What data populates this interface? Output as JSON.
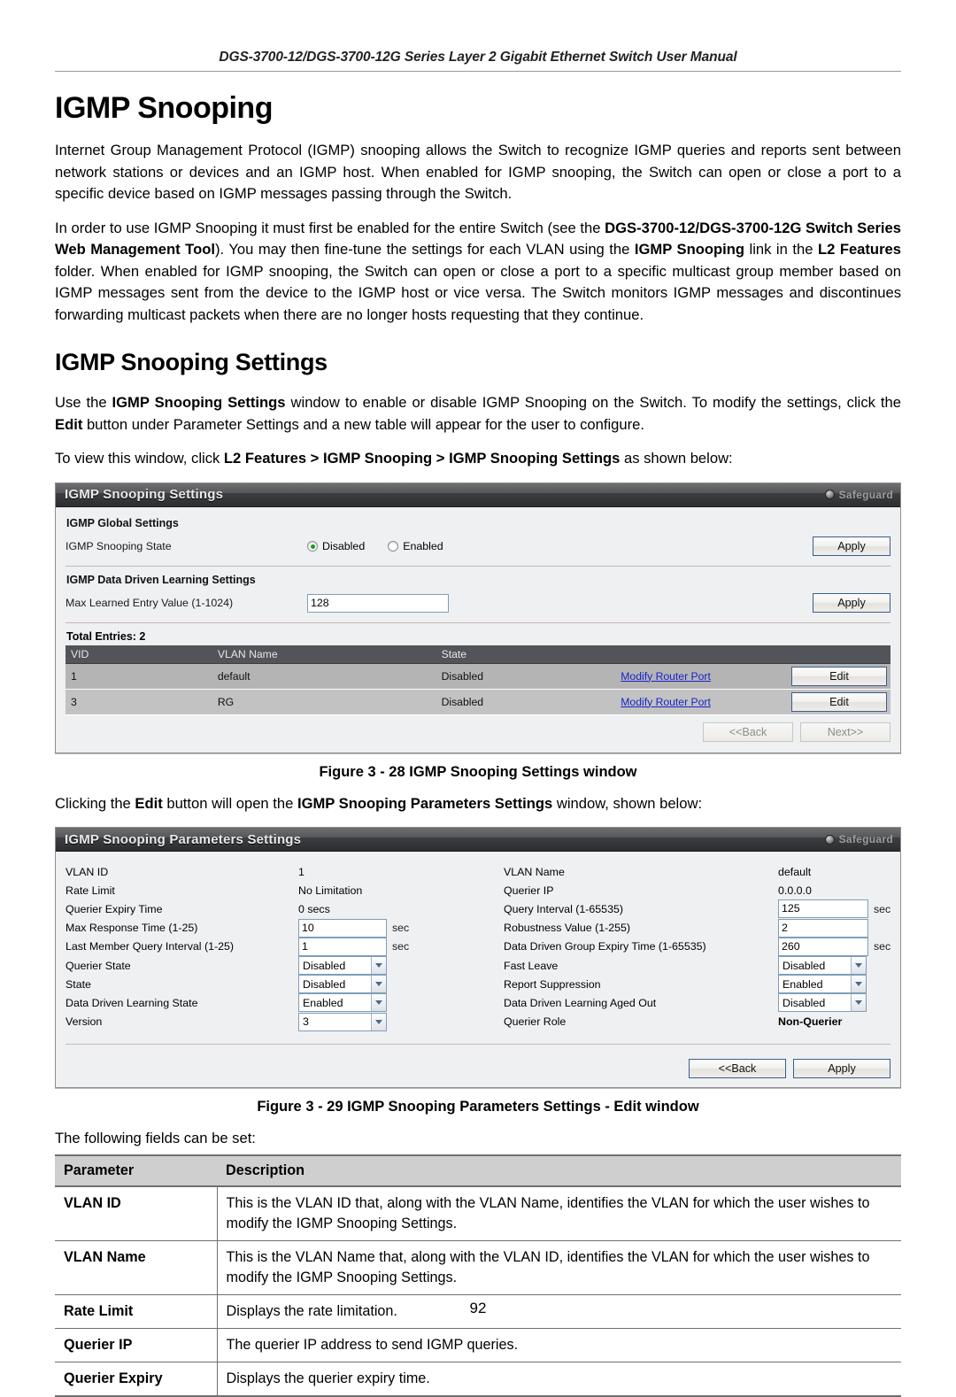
{
  "doc": {
    "running_header": "DGS-3700-12/DGS-3700-12G Series Layer 2 Gigabit Ethernet Switch User Manual",
    "page_number": "92"
  },
  "headings": {
    "h1": "IGMP Snooping",
    "h2": "IGMP Snooping Settings"
  },
  "paragraphs": {
    "p1": "Internet Group Management Protocol (IGMP) snooping allows the Switch to recognize IGMP queries and reports sent between network stations or devices and an IGMP host. When enabled for IGMP snooping, the Switch can open or close a port to a specific device based on IGMP messages passing through the Switch.",
    "p2_a": "In order to use IGMP Snooping it must first be enabled for the entire Switch (see the ",
    "p2_b": "DGS-3700-12/DGS-3700-12G Switch Series Web Management Tool",
    "p2_c": "). You may then fine-tune the settings for each VLAN using the ",
    "p2_d": "IGMP Snooping",
    "p2_e": " link in the ",
    "p2_f": "L2 Features",
    "p2_g": " folder. When enabled for IGMP snooping, the Switch can open or close a port to a specific multicast group member based on IGMP messages sent from the device to the IGMP host or vice versa. The Switch monitors IGMP messages and discontinues forwarding multicast packets when there are no longer hosts requesting that they continue.",
    "p3_a": "Use the ",
    "p3_b": "IGMP Snooping Settings",
    "p3_c": " window to enable or disable IGMP Snooping on the Switch. To modify the settings, click the ",
    "p3_d": "Edit",
    "p3_e": " button under Parameter Settings and a new table will appear for the user to configure.",
    "p4_a": "To view this window, click ",
    "p4_b": "L2 Features > IGMP Snooping > IGMP Snooping Settings",
    "p4_c": " as shown below:",
    "p5_a": "Clicking the ",
    "p5_b": "Edit",
    "p5_c": " button will open the ",
    "p5_d": "IGMP Snooping Parameters Settings",
    "p5_e": " window, shown below:",
    "p6": "The following fields can be set:"
  },
  "captions": {
    "fig28": "Figure 3 - 28 IGMP Snooping Settings window",
    "fig29": "Figure 3 - 29 IGMP Snooping Parameters Settings - Edit window"
  },
  "panel1": {
    "title": "IGMP Snooping Settings",
    "safeguard": "Safeguard",
    "group1_title": "IGMP Global Settings",
    "snooping_state_label": "IGMP Snooping State",
    "radio_disabled": "Disabled",
    "radio_enabled": "Enabled",
    "apply1": "Apply",
    "group2_title": "IGMP Data Driven Learning Settings",
    "max_learned_label": "Max Learned Entry Value (1-1024)",
    "max_learned_value": "128",
    "apply2": "Apply",
    "total_entries": "Total Entries: 2",
    "columns": [
      "VID",
      "VLAN Name",
      "State",
      "",
      ""
    ],
    "rows": [
      {
        "vid": "1",
        "vlan_name": "default",
        "state": "Disabled",
        "link": "Modify Router Port",
        "edit": "Edit"
      },
      {
        "vid": "3",
        "vlan_name": "RG",
        "state": "Disabled",
        "link": "Modify Router Port",
        "edit": "Edit"
      }
    ],
    "back": "<<Back",
    "next": "Next>>"
  },
  "panel2": {
    "title": "IGMP Snooping Parameters Settings",
    "safeguard": "Safeguard",
    "fields": [
      {
        "label": "VLAN ID",
        "value": "1",
        "type": "text_static",
        "label2": "VLAN Name",
        "value2": "default",
        "type2": "text_static"
      },
      {
        "label": "Rate Limit",
        "value": "No Limitation",
        "type": "text_static",
        "label2": "Querier IP",
        "value2": "0.0.0.0",
        "type2": "text_static"
      },
      {
        "label": "Querier Expiry Time",
        "value": "0 secs",
        "type": "text_static",
        "label2": "Query Interval (1-65535)",
        "value2": "125",
        "type2": "input",
        "unit2": "sec"
      },
      {
        "label": "Max Response Time (1-25)",
        "value": "10",
        "type": "input",
        "unit": "sec",
        "label2": "Robustness Value (1-255)",
        "value2": "2",
        "type2": "input",
        "unit2": ""
      },
      {
        "label": "Last Member Query Interval (1-25)",
        "value": "1",
        "type": "input",
        "unit": "sec",
        "label2": "Data Driven Group Expiry Time (1-65535)",
        "value2": "260",
        "type2": "input",
        "unit2": "sec"
      },
      {
        "label": "Querier State",
        "value": "Disabled",
        "type": "select",
        "label2": "Fast Leave",
        "value2": "Disabled",
        "type2": "select"
      },
      {
        "label": "State",
        "value": "Disabled",
        "type": "select",
        "label2": "Report Suppression",
        "value2": "Enabled",
        "type2": "select"
      },
      {
        "label": "Data Driven Learning State",
        "value": "Enabled",
        "type": "select",
        "label2": "Data Driven Learning Aged Out",
        "value2": "Disabled",
        "type2": "select"
      },
      {
        "label": "Version",
        "value": "3",
        "type": "select",
        "label2": "Querier Role",
        "value2": "Non-Querier",
        "type2": "bold_static"
      }
    ],
    "back": "<<Back",
    "apply": "Apply"
  },
  "desc_table": {
    "header": {
      "parameter": "Parameter",
      "description": "Description"
    },
    "rows": [
      {
        "parameter": "VLAN ID",
        "description": "This is the VLAN ID that, along with the VLAN Name, identifies the VLAN for which the user wishes to modify the IGMP Snooping Settings."
      },
      {
        "parameter": "VLAN Name",
        "description": "This is the VLAN Name that, along with the VLAN ID, identifies the VLAN for which the user wishes to modify the IGMP Snooping Settings."
      },
      {
        "parameter": "Rate Limit",
        "description": "Displays the rate limitation."
      },
      {
        "parameter": "Querier IP",
        "description": "The querier IP address to send IGMP queries."
      },
      {
        "parameter": "Querier Expiry",
        "description": "Displays the querier expiry time."
      }
    ]
  },
  "colors": {
    "link": "#1a22c8",
    "radio_on": "#1a9b1a",
    "panel_bg": "#eef0f2",
    "titlebar": "#2c2d30"
  }
}
